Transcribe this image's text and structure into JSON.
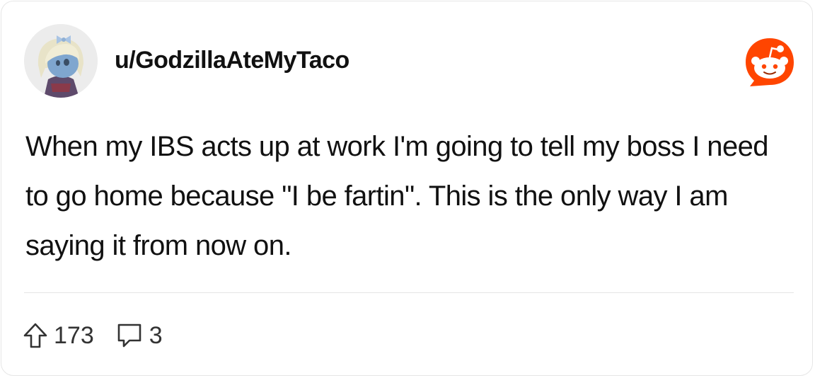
{
  "post": {
    "username": "u/GodzillaAteMyTaco",
    "body": "When my IBS acts up at work I'm going to tell my boss I need to go home because \"I be fartin\". This is the only way I am saying it from now on.",
    "upvotes": "173",
    "comments": "3"
  },
  "icons": {
    "avatar": "snoo-avatar",
    "brand": "reddit-logo-icon",
    "upvote": "upvote-arrow-icon",
    "comment": "comment-bubble-icon"
  },
  "colors": {
    "brand": "#ff4500",
    "text": "#111111",
    "muted": "#333333",
    "divider": "#e4e4e4"
  }
}
